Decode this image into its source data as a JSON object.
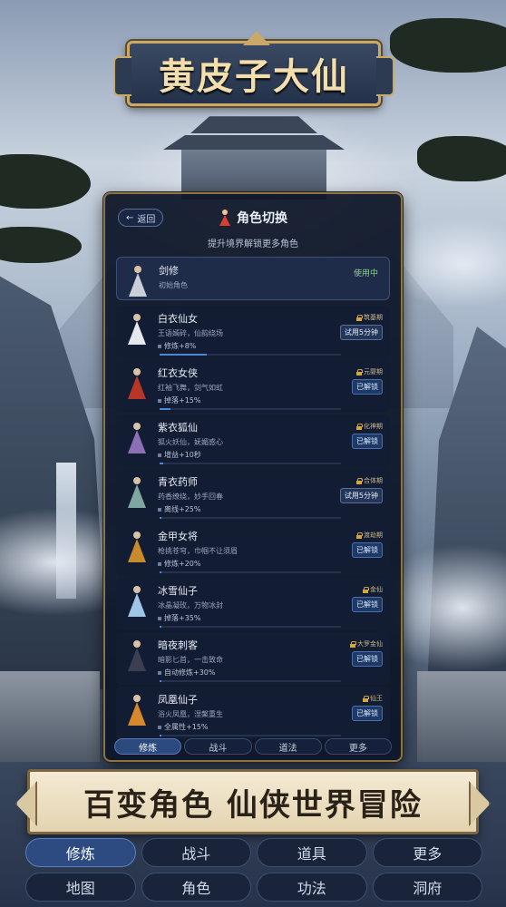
{
  "game": {
    "title": "黄皮子大仙"
  },
  "panel": {
    "back_label": "返回",
    "title": "角色切换",
    "subtitle": "提升境界解锁更多角色"
  },
  "characters": [
    {
      "name": "剑修",
      "desc": "初始角色",
      "status": "使用中",
      "robe_color": "#c9ced8"
    },
    {
      "name": "白衣仙女",
      "desc": "王语嫣碎，仙韵绕场",
      "bonus": "修炼+8%",
      "realm": "筑基期",
      "status": "试用5分钟",
      "progress": 0.26,
      "robe_color": "#e6e8ee"
    },
    {
      "name": "红衣女侠",
      "desc": "红袖飞舞，剑气如虹",
      "bonus": "掉落+15%",
      "realm": "元婴期",
      "status": "已解锁",
      "progress": 0.06,
      "robe_color": "#b8352a"
    },
    {
      "name": "紫衣狐仙",
      "desc": "狐火妖仙，妩媚惑心",
      "bonus": "增益+10秒",
      "realm": "化神期",
      "status": "已解锁",
      "progress": 0.02,
      "robe_color": "#8d6fb5"
    },
    {
      "name": "青衣药师",
      "desc": "药香缭绕，妙手回春",
      "bonus": "离线+25%",
      "realm": "合体期",
      "status": "试用5分钟",
      "progress": 0.01,
      "robe_color": "#7fa6a0"
    },
    {
      "name": "金甲女将",
      "desc": "枪挑苍穹，巾帼不让须眉",
      "bonus": "修炼+20%",
      "realm": "渡劫期",
      "status": "已解锁",
      "progress": 0.01,
      "robe_color": "#c98a2e"
    },
    {
      "name": "冰雪仙子",
      "desc": "冰晶凝玫，万物冰封",
      "bonus": "掉落+35%",
      "realm": "金仙",
      "status": "已解锁",
      "progress": 0.01,
      "robe_color": "#9fc6e6"
    },
    {
      "name": "暗夜刺客",
      "desc": "暗影匕首，一击致命",
      "bonus": "自动修炼+30%",
      "realm": "大罗金仙",
      "status": "已解锁",
      "progress": 0.01,
      "robe_color": "#3a3f52"
    },
    {
      "name": "凤凰仙子",
      "desc": "浴火凤凰，涅槃重生",
      "bonus": "全属性+15%",
      "realm": "仙王",
      "status": "已解锁",
      "progress": 0.01,
      "robe_color": "#d4892c"
    }
  ],
  "panel_tabs": [
    "修炼",
    "战斗",
    "道法",
    "更多"
  ],
  "banner": {
    "text": "百变角色 仙侠世界冒险"
  },
  "bottom_nav": [
    "修炼",
    "战斗",
    "道具",
    "更多",
    "地图",
    "角色",
    "功法",
    "洞府"
  ],
  "colors": {
    "accent": "#2d4b80",
    "gold": "#c9a86a",
    "panel_bg": "#0e1628"
  }
}
